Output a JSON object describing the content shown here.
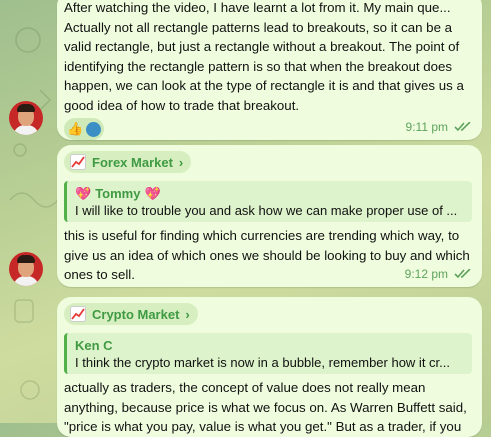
{
  "messages": [
    {
      "cut_line": "After watching the video, I have learnt a lot from it. My main que...",
      "text": "Actually not all rectangle patterns lead to breakouts, so it can be a valid rectangle, but just a rectangle without a breakout. The point of identifying the rectangle pattern is so that when the breakout does happen, we can look at the type of rectangle it is and that gives us a good idea of how to trade that breakout.",
      "reaction_emoji": "👍",
      "time": "9:11 pm"
    },
    {
      "topic": "Forex Market",
      "topic_icon": "chart-increasing-icon",
      "reply_author": "Tommy",
      "reply_author_emoji": "💖",
      "reply_text": "I will like to trouble you and ask how we can make proper use of ...",
      "text": "this is useful for finding which currencies are trending which way, to give us an idea of which ones we should be looking to buy and which ones to sell.",
      "time": "9:12 pm"
    },
    {
      "topic": "Crypto Market",
      "topic_icon": "chart-increasing-icon",
      "reply_author": "Ken C",
      "reply_text": "I think the crypto market is now in a bubble, remember how it cr...",
      "text": "actually as traders, the concept of value does not really mean anything, because price is what we focus on. As Warren Buffett said, \"price is what you pay, value is what you get.\" But as a trader, if you"
    }
  ],
  "colors": {
    "bubble": "#effdde",
    "accent": "#3f9a43",
    "time": "#5ea25d"
  }
}
